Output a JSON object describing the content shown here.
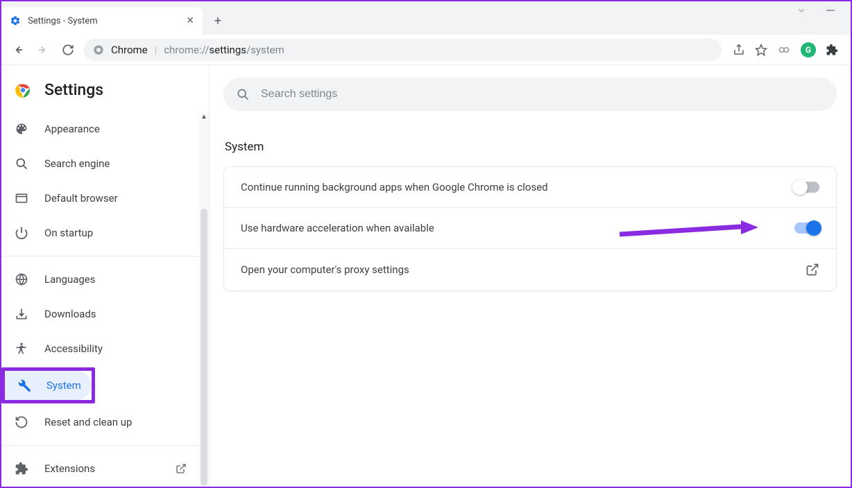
{
  "tab": {
    "title": "Settings - System"
  },
  "omnibox": {
    "prefix": "Chrome",
    "url_dim": "chrome://",
    "url_mid": "settings",
    "url_end": "/system"
  },
  "header": {
    "title": "Settings"
  },
  "search": {
    "placeholder": "Search settings"
  },
  "sidebar": {
    "items": [
      {
        "label": "Appearance"
      },
      {
        "label": "Search engine"
      },
      {
        "label": "Default browser"
      },
      {
        "label": "On startup"
      },
      {
        "label": "Languages"
      },
      {
        "label": "Downloads"
      },
      {
        "label": "Accessibility"
      },
      {
        "label": "System"
      },
      {
        "label": "Reset and clean up"
      },
      {
        "label": "Extensions"
      }
    ]
  },
  "section": {
    "title": "System"
  },
  "rows": {
    "r0": {
      "label": "Continue running background apps when Google Chrome is closed",
      "toggle": "off"
    },
    "r1": {
      "label": "Use hardware acceleration when available",
      "toggle": "on"
    },
    "r2": {
      "label": "Open your computer's proxy settings"
    }
  },
  "annotation": {
    "highlighted_item": "System",
    "arrow_target": "hardware-acceleration-toggle"
  }
}
